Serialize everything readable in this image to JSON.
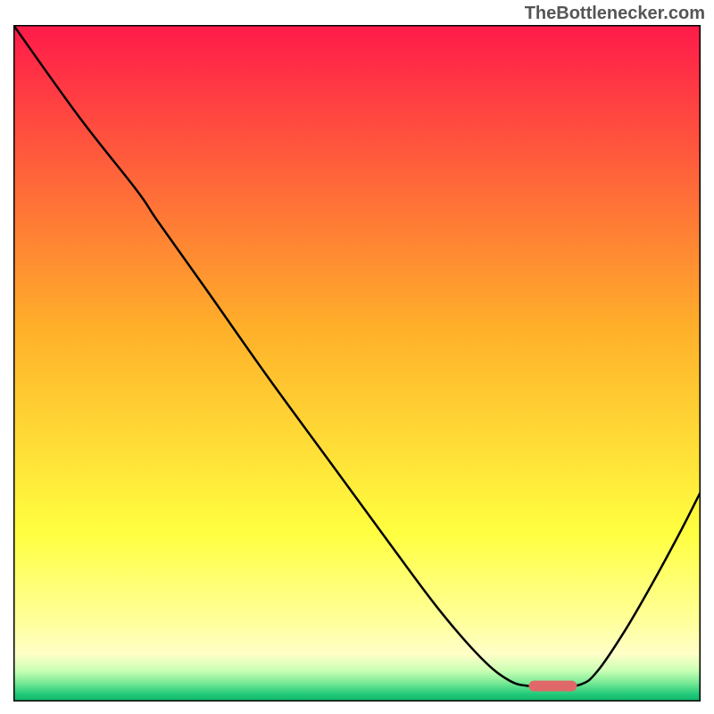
{
  "watermark": "TheBottlenecker.com",
  "chart_data": {
    "type": "line",
    "x_range": [
      0,
      100
    ],
    "y_range": [
      0,
      100
    ],
    "gradient_stops": [
      {
        "offset": 0.0,
        "color": "#ff1a4a"
      },
      {
        "offset": 0.45,
        "color": "#ffb02a"
      },
      {
        "offset": 0.75,
        "color": "#ffff40"
      },
      {
        "offset": 0.88,
        "color": "#ffff9a"
      },
      {
        "offset": 0.93,
        "color": "#ffffc8"
      },
      {
        "offset": 0.955,
        "color": "#c8ffb4"
      },
      {
        "offset": 0.972,
        "color": "#7aea96"
      },
      {
        "offset": 0.99,
        "color": "#1ec878"
      },
      {
        "offset": 1.0,
        "color": "#12b36a"
      }
    ],
    "curve_points": [
      {
        "x": 0.0,
        "y": 100.0
      },
      {
        "x": 9.5,
        "y": 86.5
      },
      {
        "x": 18.0,
        "y": 75.5
      },
      {
        "x": 21.0,
        "y": 71.0
      },
      {
        "x": 28.0,
        "y": 61.0
      },
      {
        "x": 37.0,
        "y": 48.0
      },
      {
        "x": 46.0,
        "y": 35.5
      },
      {
        "x": 55.0,
        "y": 23.0
      },
      {
        "x": 62.0,
        "y": 13.5
      },
      {
        "x": 68.0,
        "y": 6.5
      },
      {
        "x": 72.0,
        "y": 3.2
      },
      {
        "x": 75.0,
        "y": 2.3
      },
      {
        "x": 79.0,
        "y": 2.3
      },
      {
        "x": 82.5,
        "y": 2.5
      },
      {
        "x": 85.0,
        "y": 4.5
      },
      {
        "x": 89.0,
        "y": 10.5
      },
      {
        "x": 93.0,
        "y": 17.5
      },
      {
        "x": 97.0,
        "y": 25.0
      },
      {
        "x": 100.0,
        "y": 31.0
      }
    ],
    "marker": {
      "x_start": 75.0,
      "x_end": 82.0,
      "y": 2.3,
      "color": "#e06868"
    }
  }
}
